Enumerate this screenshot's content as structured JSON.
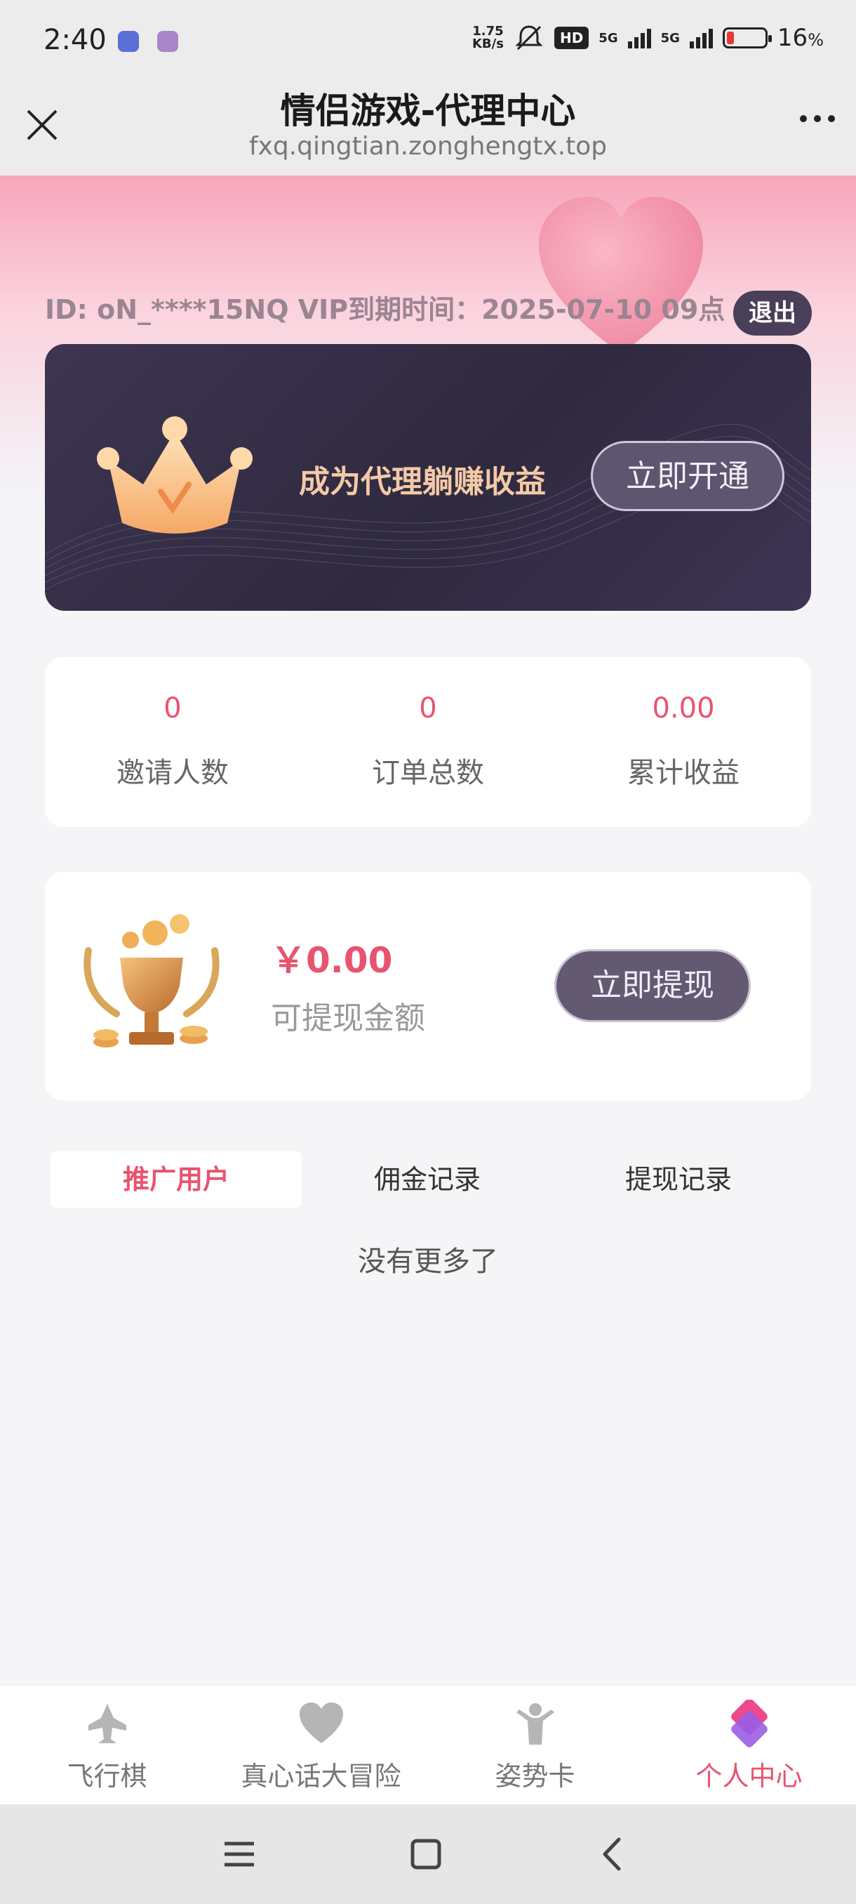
{
  "status_bar": {
    "time": "2:40",
    "net_speed_value": "1.75",
    "net_speed_unit": "KB/s",
    "hd_label": "HD",
    "sim1_label": "5G",
    "sim2_label": "5G",
    "battery_percent": "16",
    "battery_unit": "%"
  },
  "title_bar": {
    "title": "情侣游戏-代理中心",
    "subtitle": "fxq.qingtian.zonghengtx.top"
  },
  "header": {
    "id_line": "ID: oN_****15NQ VIP到期时间：2025-07-10 09点",
    "logout_label": "退出"
  },
  "agent_card": {
    "slogan": "成为代理躺赚收益",
    "open_label": "立即开通"
  },
  "stats": [
    {
      "value": "0",
      "label": "邀请人数"
    },
    {
      "value": "0",
      "label": "订单总数"
    },
    {
      "value": "0.00",
      "label": "累计收益"
    }
  ],
  "withdraw": {
    "amount": "￥0.00",
    "amount_label": "可提现金额",
    "button_label": "立即提现"
  },
  "tabs": [
    {
      "label": "推广用户",
      "active": true
    },
    {
      "label": "佣金记录",
      "active": false
    },
    {
      "label": "提现记录",
      "active": false
    }
  ],
  "empty_text": "没有更多了",
  "bottom_nav": [
    {
      "label": "飞行棋",
      "icon": "plane-icon"
    },
    {
      "label": "真心话大冒险",
      "icon": "heart-icon"
    },
    {
      "label": "姿势卡",
      "icon": "person-icon"
    },
    {
      "label": "个人中心",
      "icon": "profile-icon",
      "active": true
    }
  ],
  "colors": {
    "accent": "#e8546f",
    "card_dark": "#3e3550",
    "header_pink": "#f7a6bb"
  }
}
